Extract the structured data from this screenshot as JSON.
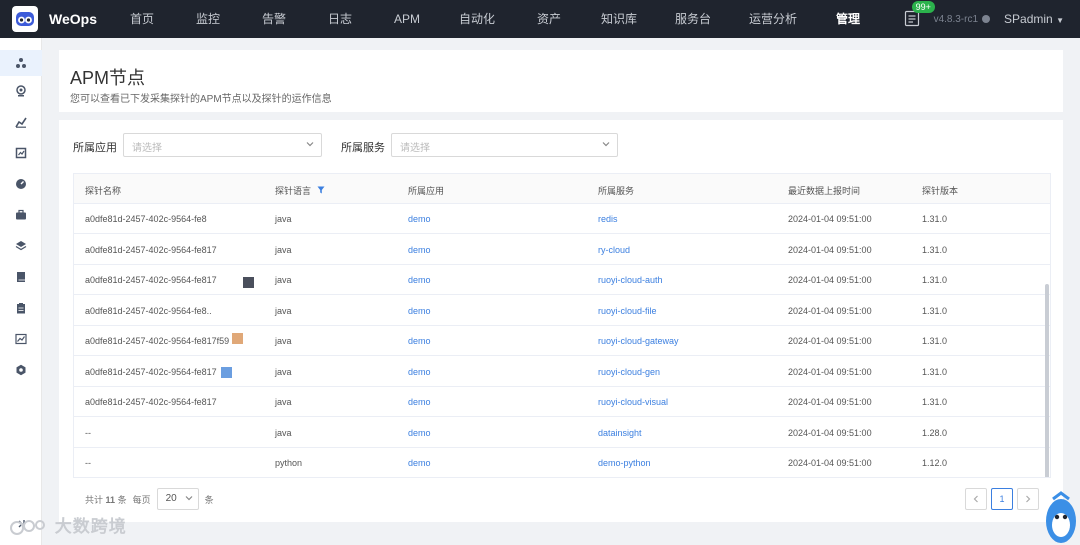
{
  "brand": "WeOps",
  "nav": [
    {
      "label": "首页",
      "active": false
    },
    {
      "label": "监控",
      "active": false
    },
    {
      "label": "告警",
      "active": false
    },
    {
      "label": "日志",
      "active": false
    },
    {
      "label": "APM",
      "active": false
    },
    {
      "label": "自动化",
      "active": false
    },
    {
      "label": "资产",
      "active": false
    },
    {
      "label": "知识库",
      "active": false
    },
    {
      "label": "服务台",
      "active": false
    },
    {
      "label": "运营分析",
      "active": false
    },
    {
      "label": "管理",
      "active": true
    }
  ],
  "notice_badge": "99+",
  "version": "v4.8.3-rc1",
  "user": "SPadmin",
  "page": {
    "title": "APM节点",
    "description": "您可以查看已下发采集探针的APM节点以及探针的运作信息"
  },
  "filters": {
    "app_label": "所属应用",
    "app_placeholder": "请选择",
    "service_label": "所属服务",
    "service_placeholder": "请选择"
  },
  "table": {
    "headers": [
      "探针名称",
      "探针语言",
      "所属应用",
      "所属服务",
      "最近数据上报时间",
      "探针版本"
    ],
    "rows": [
      {
        "name": "a0dfe81d-2457-402c-9564-fe8",
        "lang": "java",
        "app": "demo",
        "service": "redis",
        "time": "2024-01-04 09:51:00",
        "version": "1.31.0"
      },
      {
        "name": "a0dfe81d-2457-402c-9564-fe817",
        "lang": "java",
        "app": "demo",
        "service": "ry-cloud",
        "time": "2024-01-04 09:51:00",
        "version": "1.31.0"
      },
      {
        "name": "a0dfe81d-2457-402c-9564-fe817",
        "lang": "java",
        "app": "demo",
        "service": "ruoyi-cloud-auth",
        "time": "2024-01-04 09:51:00",
        "version": "1.31.0"
      },
      {
        "name": "a0dfe81d-2457-402c-9564-fe8..",
        "lang": "java",
        "app": "demo",
        "service": "ruoyi-cloud-file",
        "time": "2024-01-04 09:51:00",
        "version": "1.31.0"
      },
      {
        "name": "a0dfe81d-2457-402c-9564-fe817f59",
        "lang": "java",
        "app": "demo",
        "service": "ruoyi-cloud-gateway",
        "time": "2024-01-04 09:51:00",
        "version": "1.31.0"
      },
      {
        "name": "a0dfe81d-2457-402c-9564-fe817",
        "lang": "java",
        "app": "demo",
        "service": "ruoyi-cloud-gen",
        "time": "2024-01-04 09:51:00",
        "version": "1.31.0"
      },
      {
        "name": "a0dfe81d-2457-402c-9564-fe817",
        "lang": "java",
        "app": "demo",
        "service": "ruoyi-cloud-visual",
        "time": "2024-01-04 09:51:00",
        "version": "1.31.0"
      },
      {
        "name": "--",
        "lang": "java",
        "app": "demo",
        "service": "datainsight",
        "time": "2024-01-04 09:51:00",
        "version": "1.28.0"
      },
      {
        "name": "--",
        "lang": "python",
        "app": "demo",
        "service": "demo-python",
        "time": "2024-01-04 09:51:00",
        "version": "1.12.0"
      }
    ]
  },
  "pagination": {
    "total_prefix": "共计",
    "total": "11",
    "total_suffix": "条",
    "per_page_label": "每页",
    "page_size": "20",
    "page_size_suffix": "条",
    "current_page": "1"
  },
  "watermark": "大数跨境",
  "colors": {
    "nav_bg": "#1f242e",
    "link": "#3b7fe0",
    "badge": "#2bb24c"
  }
}
